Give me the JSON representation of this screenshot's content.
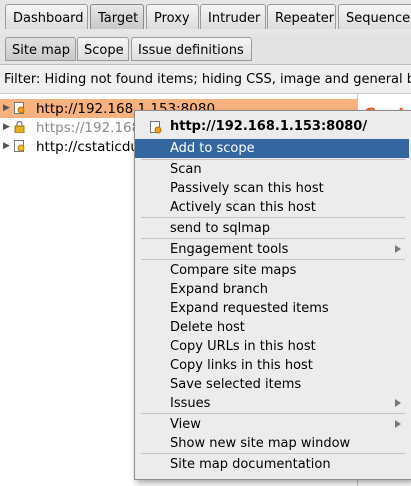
{
  "tabs": [
    "Dashboard",
    "Target",
    "Proxy",
    "Intruder",
    "Repeater",
    "Sequencer"
  ],
  "active_tab": "Target",
  "subtabs": [
    "Site map",
    "Scope",
    "Issue definitions"
  ],
  "active_subtab": "Site map",
  "filter_text": "Filter: Hiding not found items;  hiding CSS, image and general bi",
  "tree": [
    {
      "label": "http://192.168.1.153:8080",
      "selected": true,
      "icon": "host-icon",
      "secure": false
    },
    {
      "label": "https://192.168",
      "selected": false,
      "icon": "lock-icon",
      "secure": true
    },
    {
      "label": "http://cstaticdu",
      "selected": false,
      "icon": "host-icon",
      "secure": false
    }
  ],
  "right_panel": {
    "header": "Conte"
  },
  "context_menu": {
    "header": "http://192.168.1.153:8080/",
    "items": [
      {
        "label": "Add to scope",
        "highlighted": true
      },
      {
        "label": "Scan"
      },
      {
        "label": "Passively scan this host"
      },
      {
        "label": "Actively scan this host"
      },
      {
        "label": "send to sqlmap"
      },
      {
        "label": "Engagement tools",
        "submenu": true
      },
      {
        "label": "Compare site maps"
      },
      {
        "label": "Expand branch"
      },
      {
        "label": "Expand requested items"
      },
      {
        "label": "Delete host"
      },
      {
        "label": "Copy URLs in this host"
      },
      {
        "label": "Copy links in this host"
      },
      {
        "label": "Save selected items"
      },
      {
        "label": "Issues",
        "submenu": true
      },
      {
        "label": "View",
        "submenu": true
      },
      {
        "label": "Show new site map window"
      },
      {
        "label": "Site map documentation"
      }
    ]
  },
  "colors": {
    "selection": "#f7b27f",
    "menu_highlight": "#34679f",
    "accent": "#e8632b"
  }
}
